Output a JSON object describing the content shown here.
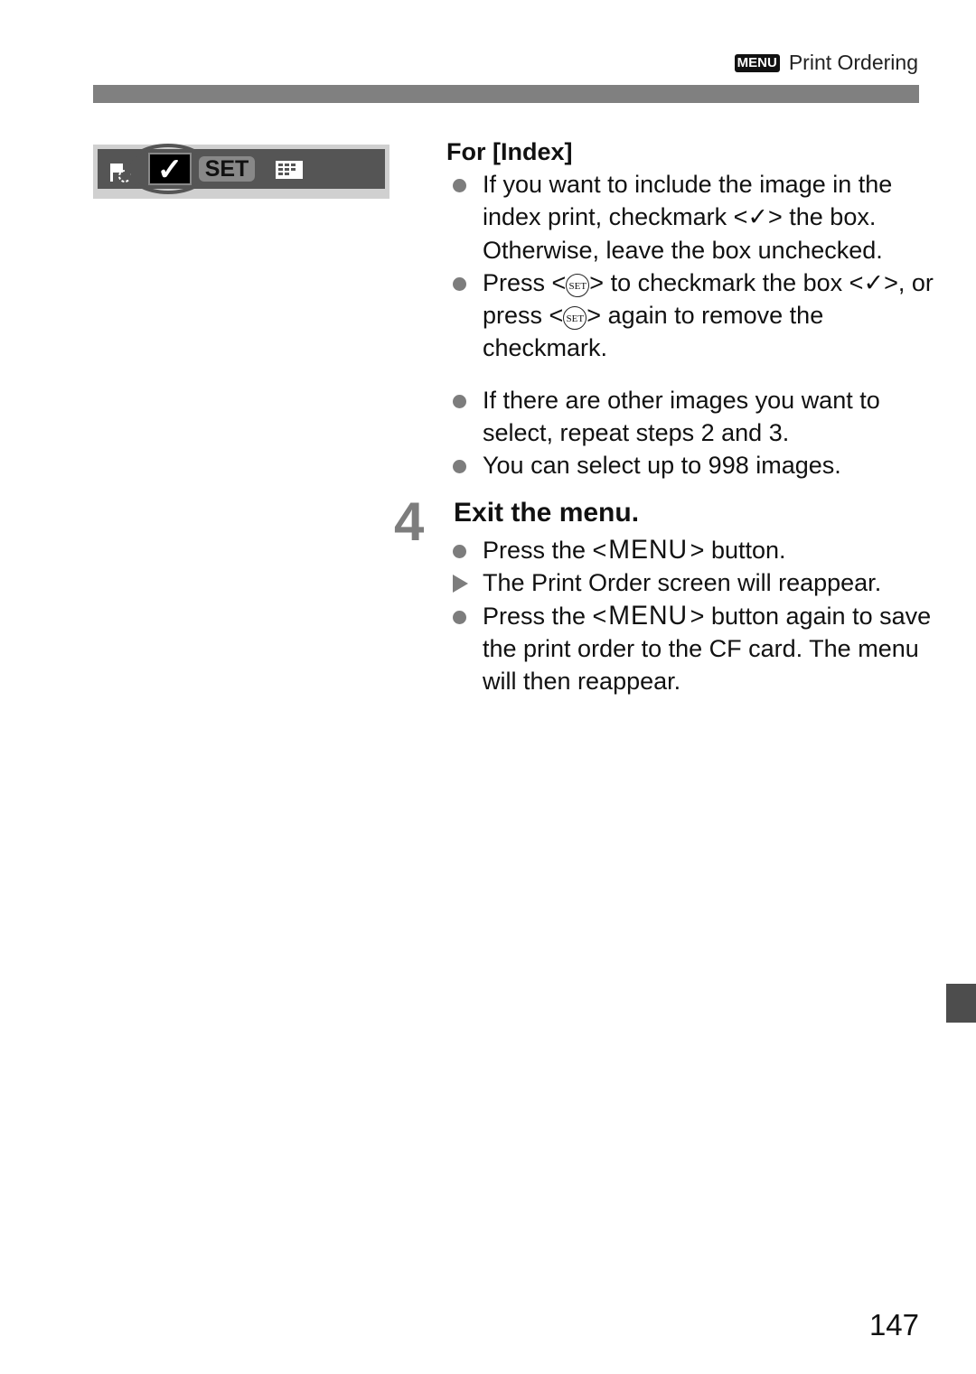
{
  "header": {
    "menu_badge": "MENU",
    "section_title": "Print Ordering"
  },
  "screen": {
    "check_glyph": "✓",
    "set_label": "SET"
  },
  "for_index": {
    "heading": "For [Index]",
    "bullets": [
      {
        "type": "dot",
        "parts": [
          "If you want to include the image in the index print, checkmark <",
          "✓",
          "> the box. Otherwise, leave the box unchecked."
        ]
      },
      {
        "type": "dot",
        "parts": [
          "Press <",
          "SET",
          "> to checkmark the box <",
          "✓",
          ">, or press <",
          "SET",
          "> again to remove the checkmark."
        ]
      },
      {
        "type": "dot",
        "text": "If there are other images you want to select, repeat steps 2 and 3."
      },
      {
        "type": "dot",
        "text": "You can select up to 998 images."
      }
    ]
  },
  "step4": {
    "number": "4",
    "title": "Exit the menu.",
    "bullets": [
      {
        "type": "dot",
        "before": "Press the <",
        "menu": "MENU",
        "after": "> button."
      },
      {
        "type": "arrow",
        "text": "The Print Order screen will reappear."
      },
      {
        "type": "dot",
        "before": "Press the <",
        "menu": "MENU",
        "after": "> button again to save the print order to the CF card. The menu will then reappear."
      }
    ]
  },
  "footer": {
    "page_number": "147"
  },
  "colors": {
    "rule": "#808080",
    "bullet": "#7d7d7d",
    "thumb_tab": "#4d4d4d"
  }
}
